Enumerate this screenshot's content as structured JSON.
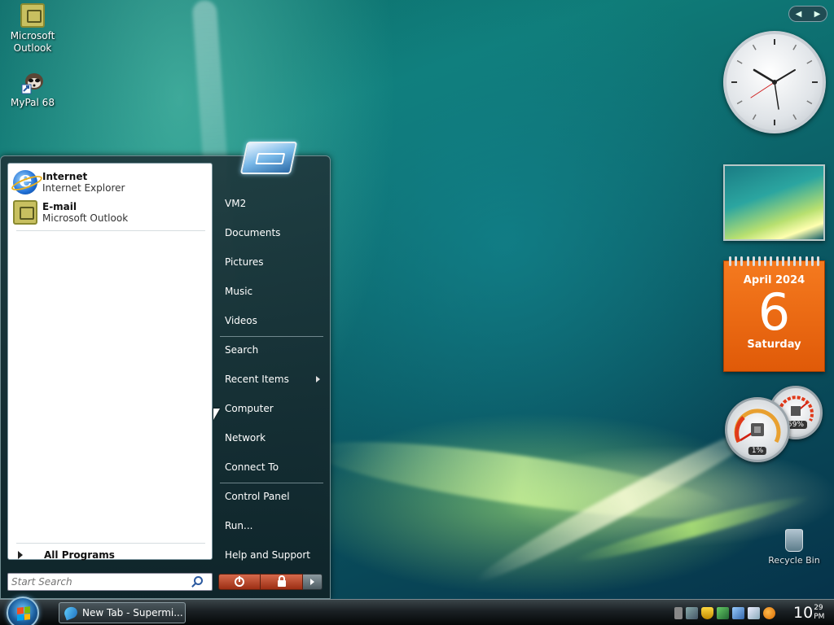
{
  "desktop": {
    "icons": [
      {
        "label": "Microsoft Outlook",
        "icon": "outlook-icon"
      },
      {
        "label": "MyPal 68",
        "icon": "mypal-icon"
      }
    ],
    "recycle_bin": {
      "label": "Recycle Bin",
      "icon": "recycle-bin-icon"
    }
  },
  "gadgets": {
    "nav_prev": "◀",
    "nav_next": "▶",
    "calendar": {
      "month": "April 2024",
      "day": "6",
      "weekday": "Saturday"
    },
    "cpu_meter": {
      "cpu": "1%",
      "memory": "59%"
    }
  },
  "start_menu": {
    "pinned": [
      {
        "title": "Internet",
        "subtitle": "Internet Explorer",
        "icon": "internet-explorer-icon"
      },
      {
        "title": "E-mail",
        "subtitle": "Microsoft Outlook",
        "icon": "outlook-icon"
      }
    ],
    "all_programs": "All Programs",
    "search_placeholder": "Start Search",
    "right_items": [
      {
        "label": "VM2"
      },
      {
        "label": "Documents"
      },
      {
        "label": "Pictures"
      },
      {
        "label": "Music"
      },
      {
        "label": "Videos"
      },
      {
        "label": "Search"
      },
      {
        "label": "Recent Items"
      },
      {
        "label": "Computer"
      },
      {
        "label": "Network"
      },
      {
        "label": "Connect To"
      },
      {
        "label": "Control Panel"
      },
      {
        "label": "Run..."
      },
      {
        "label": "Help and Support"
      }
    ]
  },
  "taskbar": {
    "window_button": "New Tab - Supermi...",
    "clock": {
      "hour": "10",
      "minute": "29",
      "ampm": "PM"
    }
  },
  "colors": {
    "calendar_orange": "#e8630e",
    "power_button": "#b84428"
  }
}
